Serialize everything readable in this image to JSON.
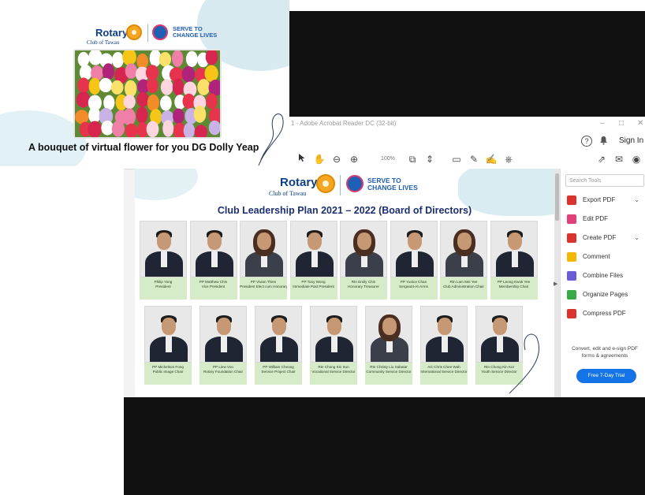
{
  "flower_slide": {
    "rotary": "Rotary",
    "club": "Club of Tawau",
    "serve_line1": "SERVE TO",
    "serve_line2": "CHANGE LIVES",
    "caption": "A bouquet of virtual flower for you DG Dolly Yeap"
  },
  "acrobat": {
    "title": "1 - Adobe Acrobat Reader DC (32-bit)",
    "win_min": "–",
    "win_max": "□",
    "win_close": "✕",
    "help": "?",
    "bell": "🔔",
    "signin": "Sign In",
    "zoom": "100%",
    "tools": [
      "hand-icon",
      "zoom-out-icon",
      "zoom-in-icon",
      "fit-page-icon",
      "scroll-icon",
      "comment-icon",
      "pen-icon",
      "sign-icon",
      "stamp-icon"
    ],
    "right_tools": [
      "share-icon",
      "mail-icon",
      "user-icon"
    ]
  },
  "document": {
    "rotary": "Rotary",
    "club": "Club of Tawau",
    "serve_line1": "SERVE TO",
    "serve_line2": "CHANGE LIVES",
    "title": "Club Leadership Plan 2021 – 2022 (Board of Directors)",
    "row1": [
      {
        "name": "Philip Yong",
        "role": "President"
      },
      {
        "name": "PP Matthew Chin",
        "role": "Vice President"
      },
      {
        "name": "PP Vivian Thien",
        "role": "President Elect cum Honorary Secretary"
      },
      {
        "name": "PP Tony Wong",
        "role": "Immediate Past President"
      },
      {
        "name": "Rtn Emily Chin",
        "role": "Honorary Treasurer"
      },
      {
        "name": "PP Yunice Chan",
        "role": "Sergeant-At-Arms"
      },
      {
        "name": "Rtn Lam Mei Yee",
        "role": "Club Administration Chair"
      },
      {
        "name": "PP Leong Kwok Yee",
        "role": "Membership Chair"
      }
    ],
    "row2": [
      {
        "name": "PP Michelson Fong",
        "role": "Public Image Chair"
      },
      {
        "name": "PP Liew Voo",
        "role": "Rotary Foundation Chair"
      },
      {
        "name": "PP William Cheong",
        "role": "Service Project Chair"
      },
      {
        "name": "Rtn Chong Kin Sun",
        "role": "Vocational Service Director"
      },
      {
        "name": "Rtn Christy Liu Sabatar",
        "role": "Community Service Director"
      },
      {
        "name": "AG Chris Chee Wah",
        "role": "International Service Director"
      },
      {
        "name": "Rtn Chong Kin Kor",
        "role": "Youth Service Director"
      }
    ]
  },
  "right_pane": {
    "search_placeholder": "Search Tools",
    "items": [
      {
        "label": "Export PDF",
        "color": "#d9342b",
        "chevron": "⌄"
      },
      {
        "label": "Edit PDF",
        "color": "#e0407b",
        "chevron": ""
      },
      {
        "label": "Create PDF",
        "color": "#d9342b",
        "chevron": "⌄"
      },
      {
        "label": "Comment",
        "color": "#f2b705",
        "chevron": ""
      },
      {
        "label": "Combine Files",
        "color": "#6b5bd6",
        "chevron": ""
      },
      {
        "label": "Organize Pages",
        "color": "#3aa845",
        "chevron": ""
      },
      {
        "label": "Compress PDF",
        "color": "#d9342b",
        "chevron": ""
      }
    ],
    "promo": "Convert, edit and e-sign PDF forms & agreements",
    "try_button": "Free 7-Day Trial"
  }
}
